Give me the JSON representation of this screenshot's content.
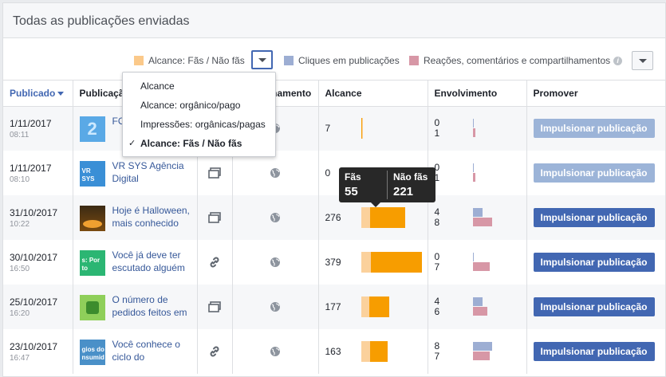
{
  "header": {
    "title": "Todas as publicações enviadas"
  },
  "legend": {
    "reach": {
      "label": "Alcance: Fãs / Não fãs",
      "color": "#fbc98a"
    },
    "clicks": {
      "label": "Cliques em publicações",
      "color": "#9daed3"
    },
    "reactions": {
      "label": "Reações, comentários e compartilhamentos",
      "color": "#d797a6"
    }
  },
  "columns": {
    "published": "Publicado",
    "post": "Publicação",
    "type": "Tipo",
    "targeting": "Direcionamento",
    "reach": "Alcance",
    "engagement": "Envolvimento",
    "promote": "Promover"
  },
  "dropdown": {
    "options": [
      {
        "label": "Alcance",
        "selected": false
      },
      {
        "label": "Alcance: orgânico/pago",
        "selected": false
      },
      {
        "label": "Impressões: orgânicas/pagas",
        "selected": false
      },
      {
        "label": "Alcance: Fãs / Não fãs",
        "selected": true
      }
    ],
    "check": "✓"
  },
  "tooltip": {
    "fans_label": "Fãs",
    "fans_value": "55",
    "nonfans_label": "Não fãs",
    "nonfans_value": "221"
  },
  "rows": [
    {
      "date": "1/11/2017",
      "time": "08:11",
      "text": "FO... VR...",
      "type": "album",
      "reach": "7",
      "fans": 1,
      "nonfans": 0,
      "clicks": "0",
      "reactions": "1",
      "clicks_n": 0,
      "reactions_n": 1,
      "promote": "Impulsionar publicação",
      "promote_enabled": false,
      "thumb": "thumb-blue-2"
    },
    {
      "date": "1/11/2017",
      "time": "08:10",
      "text": "VR SYS Agência Digital",
      "type": "album",
      "reach": "0",
      "fans": 0,
      "nonfans": 0,
      "clicks": "0",
      "reactions": "1",
      "clicks_n": 0,
      "reactions_n": 1,
      "promote": "Impulsionar publicação",
      "promote_enabled": false,
      "thumb": "VR SYS"
    },
    {
      "date": "31/10/2017",
      "time": "10:22",
      "text": "Hoje é Halloween, mais conhecido",
      "type": "album",
      "reach": "276",
      "fans": 55,
      "nonfans": 221,
      "clicks": "4",
      "reactions": "8",
      "clicks_n": 4,
      "reactions_n": 8,
      "promote": "Impulsionar publicação",
      "promote_enabled": true,
      "thumb": "thumb-halloween"
    },
    {
      "date": "30/10/2017",
      "time": "16:50",
      "text": "Você já deve ter escutado alguém",
      "type": "link",
      "reach": "379",
      "fans": 60,
      "nonfans": 319,
      "clicks": "0",
      "reactions": "7",
      "clicks_n": 0,
      "reactions_n": 7,
      "promote": "Impulsionar publicação",
      "promote_enabled": true,
      "thumb": "s: Por to"
    },
    {
      "date": "25/10/2017",
      "time": "16:20",
      "text": "O número de pedidos feitos em",
      "type": "album",
      "reach": "177",
      "fans": 50,
      "nonfans": 127,
      "clicks": "4",
      "reactions": "6",
      "clicks_n": 4,
      "reactions_n": 6,
      "promote": "Impulsionar publicação",
      "promote_enabled": true,
      "thumb": "thumb-green"
    },
    {
      "date": "23/10/2017",
      "time": "16:47",
      "text": "Você conhece o ciclo do",
      "type": "link",
      "reach": "163",
      "fans": 55,
      "nonfans": 108,
      "clicks": "8",
      "reactions": "7",
      "clicks_n": 8,
      "reactions_n": 7,
      "promote": "Impulsionar publicação",
      "promote_enabled": true,
      "thumb": "gios do nsumid"
    }
  ]
}
